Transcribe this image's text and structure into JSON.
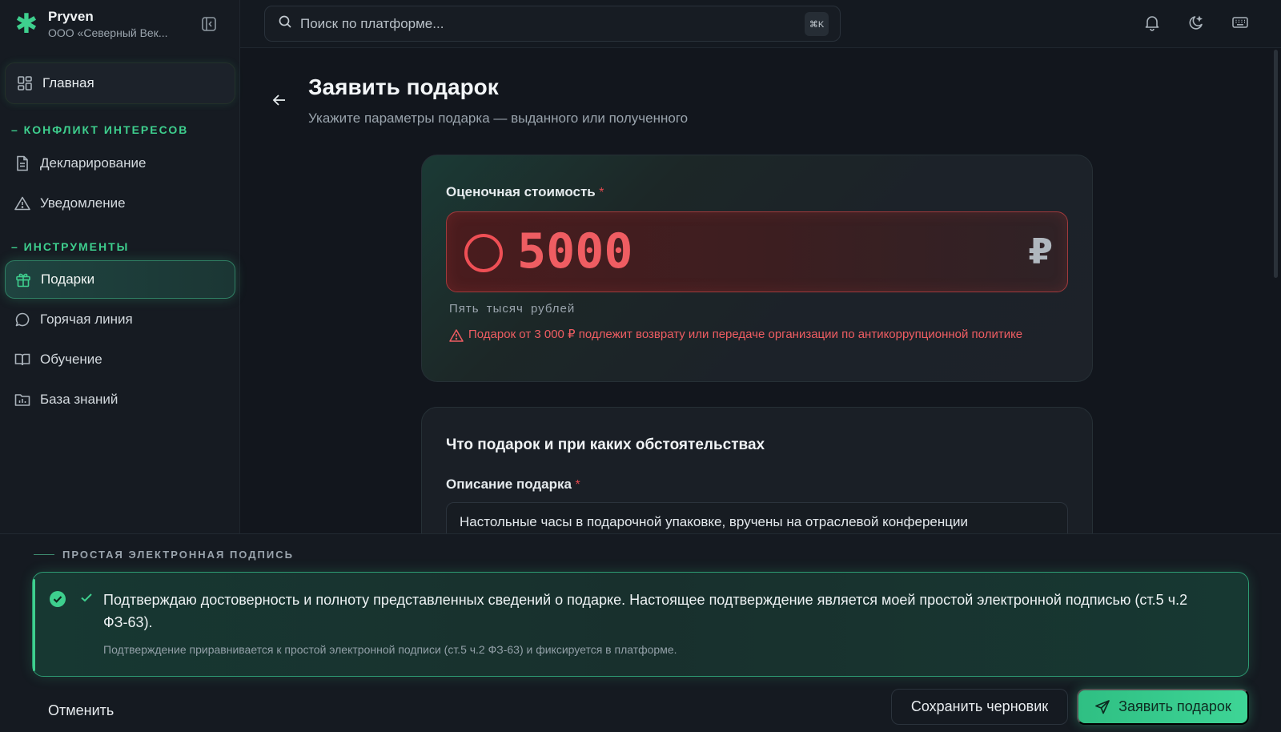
{
  "brand": {
    "name": "Pryven",
    "org": "ООО «Северный Век..."
  },
  "sidebar": {
    "home_label": "Главная",
    "section_conflict": "– КОНФЛИКТ ИНТЕРЕСОВ",
    "section_tools": "– ИНСТРУМЕНТЫ",
    "items": [
      {
        "label": "Декларирование",
        "icon": "document-icon"
      },
      {
        "label": "Уведомление",
        "icon": "warning-icon"
      },
      {
        "label": "Подарки",
        "icon": "gift-icon",
        "active": true
      },
      {
        "label": "Горячая линия",
        "icon": "chat-icon"
      },
      {
        "label": "Обучение",
        "icon": "book-icon"
      },
      {
        "label": "База знаний",
        "icon": "folder-chart-icon"
      }
    ]
  },
  "topbar": {
    "search_placeholder": "Поиск по платформе...",
    "shortcut": "⌘K"
  },
  "page": {
    "title": "Заявить подарок",
    "subtitle": "Укажите параметры подарка — выданного или полученного"
  },
  "value_card": {
    "label": "Оценочная стоимость",
    "required_mark": "*",
    "amount": "5000",
    "currency": "₽",
    "amount_words": "Пять тысяч рублей",
    "warning": "Подарок от 3 000 ₽ подлежит возврату или передаче организации по антикоррупционной политике"
  },
  "details_card": {
    "title": "Что подарок и при каких обстоятельствах",
    "desc_label": "Описание подарка",
    "required_mark": "*",
    "desc_value": "Настольные часы в подарочной упаковке, вручены на отраслевой конференции"
  },
  "signature": {
    "section_label": "ПРОСТАЯ ЭЛЕКТРОННАЯ ПОДПИСЬ",
    "confirm_text": "Подтверждаю достоверность и полноту представленных сведений о подарке. Настоящее подтверждение является моей простой электронной подписью (ст.5 ч.2 ФЗ-63).",
    "confirm_note": "Подтверждение приравнивается к простой электронной подписи (ст.5 ч.2 ФЗ-63) и фиксируется в платформе.",
    "checked": true
  },
  "actions": {
    "cancel": "Отменить",
    "save_draft": "Сохранить черновик",
    "submit": "Заявить подарок"
  },
  "colors": {
    "accent": "#3ecf8e",
    "danger": "#ef5d62",
    "bg": "#12161d"
  }
}
